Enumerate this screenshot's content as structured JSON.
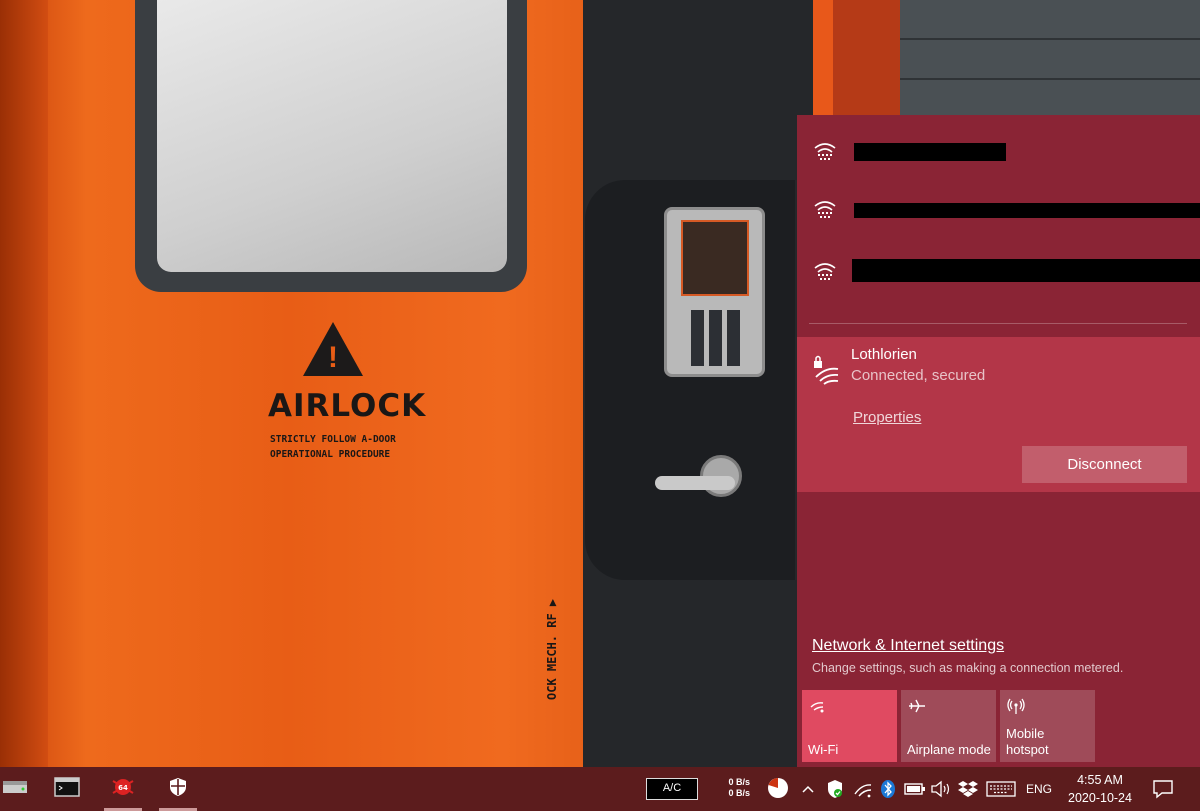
{
  "wallpaper": {
    "door_title": "AIRLOCK",
    "door_subtitle_line1": "STRICTLY FOLLOW A-DOOR",
    "door_subtitle_line2": "OPERATIONAL PROCEDURE",
    "door_vertical_text": "OCK MECH. RF ▶",
    "warning_icon": "warning-triangle-icon"
  },
  "flyout": {
    "available_networks": [
      {
        "name": "",
        "icon": "wifi-icon"
      },
      {
        "name": "",
        "icon": "wifi-icon"
      },
      {
        "name": "",
        "icon": "wifi-icon"
      }
    ],
    "connected_network": {
      "name": "Lothlorien",
      "status": "Connected, secured",
      "properties_label": "Properties",
      "disconnect_label": "Disconnect",
      "icon": "secured-wifi-icon"
    },
    "settings_link": "Network & Internet settings",
    "settings_description": "Change settings, such as making a connection metered.",
    "quick_actions": [
      {
        "label": "Wi-Fi",
        "icon": "wifi-icon",
        "state": "on"
      },
      {
        "label": "Airplane mode",
        "icon": "airplane-icon",
        "state": "off"
      },
      {
        "label": "Mobile\nhotspot",
        "icon": "hotspot-icon",
        "state": "off"
      }
    ],
    "colors": {
      "background": "#8a2435",
      "connected_row": "#b33648",
      "tile_on": "#e04a61"
    }
  },
  "taskbar": {
    "ac_label": "A/C",
    "upload_speed": "0 B/s",
    "download_speed": "0 B/s",
    "language": "ENG",
    "time": "4:55 AM",
    "date": "2020-10-24",
    "color": "#5c1c1d"
  }
}
